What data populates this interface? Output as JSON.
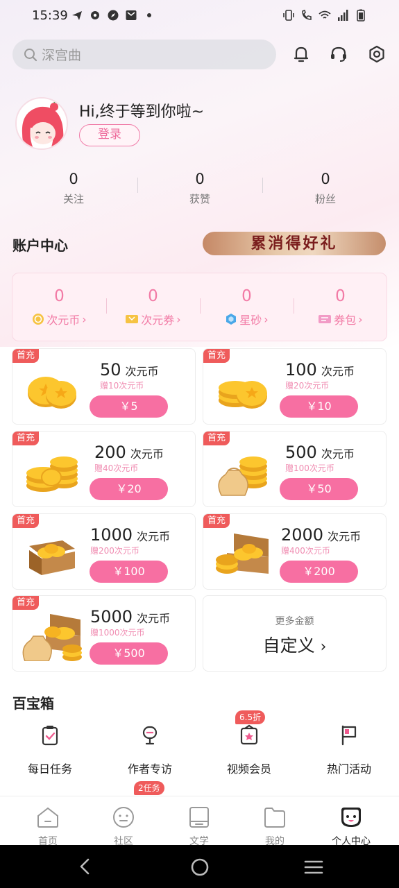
{
  "status_bar": {
    "time": "15:39"
  },
  "search": {
    "placeholder": "深宫曲"
  },
  "profile": {
    "greeting": "Hi,终于等到你啦~",
    "login_label": "登录",
    "stats": [
      {
        "value": "0",
        "label": "关注"
      },
      {
        "value": "0",
        "label": "获赞"
      },
      {
        "value": "0",
        "label": "粉丝"
      }
    ]
  },
  "account": {
    "title": "账户中心",
    "banner_text": "累消得好礼",
    "wallet": [
      {
        "value": "0",
        "label": "次元币",
        "icon": "coin-icon"
      },
      {
        "value": "0",
        "label": "次元券",
        "icon": "ticket-icon"
      },
      {
        "value": "0",
        "label": "星砂",
        "icon": "gem-icon"
      },
      {
        "value": "0",
        "label": "券包",
        "icon": "voucher-icon"
      }
    ]
  },
  "recharge": {
    "badge": "首充",
    "unit": "次元币",
    "options": [
      {
        "amount": "50",
        "bonus": "赠10次元币",
        "price": "￥5"
      },
      {
        "amount": "100",
        "bonus": "赠20次元币",
        "price": "￥10"
      },
      {
        "amount": "200",
        "bonus": "赠40次元币",
        "price": "￥20"
      },
      {
        "amount": "500",
        "bonus": "赠100次元币",
        "price": "￥50"
      },
      {
        "amount": "1000",
        "bonus": "赠200次元币",
        "price": "￥100"
      },
      {
        "amount": "2000",
        "bonus": "赠400次元币",
        "price": "￥200"
      },
      {
        "amount": "5000",
        "bonus": "赠1000次元币",
        "price": "￥500"
      }
    ],
    "custom": {
      "subtitle": "更多金额",
      "title": "自定义"
    }
  },
  "treasure": {
    "title": "百宝箱",
    "items": [
      {
        "label": "每日任务",
        "icon": "clipboard-check-icon"
      },
      {
        "label": "作者专访",
        "icon": "microphone-icon"
      },
      {
        "label": "视频会员",
        "icon": "video-member-icon",
        "badge": "6.5折"
      },
      {
        "label": "热门活动",
        "icon": "flag-icon"
      }
    ]
  },
  "bottom_nav": {
    "items": [
      {
        "label": "首页",
        "icon": "home-icon"
      },
      {
        "label": "社区",
        "icon": "community-icon",
        "badge": "2任务"
      },
      {
        "label": "文学",
        "icon": "book-icon"
      },
      {
        "label": "我的",
        "icon": "folder-icon"
      },
      {
        "label": "个人中心",
        "icon": "profile-face-icon",
        "active": true
      }
    ]
  },
  "colors": {
    "accent_pink": "#f76fa2",
    "badge_red": "#ef5b5b",
    "wallet_text": "#f27aa5"
  }
}
